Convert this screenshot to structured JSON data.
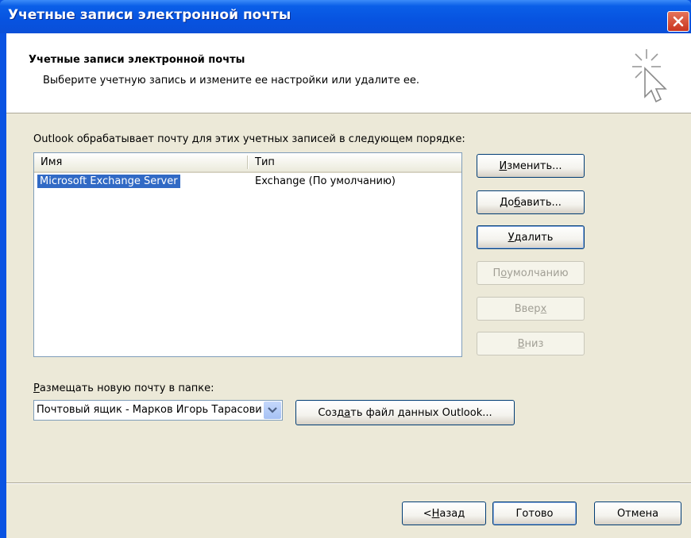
{
  "window": {
    "title": "Учетные записи электронной почты",
    "close_icon": "close-icon"
  },
  "header": {
    "title": "Учетные записи электронной почты",
    "subtitle": "Выберите учетную запись и измените ее настройки или удалите ее."
  },
  "accounts": {
    "intro": "Outlook обрабатывает почту для этих учетных записей в следующем порядке:",
    "columns": [
      "Имя",
      "Тип"
    ],
    "rows": [
      {
        "name": "Microsoft Exchange Server",
        "type": "Exchange (По умолчанию)",
        "selected": true
      }
    ]
  },
  "buttons": {
    "change": {
      "pre": "",
      "key": "И",
      "post": "зменить..."
    },
    "add": {
      "pre": "До",
      "key": "б",
      "post": "авить..."
    },
    "remove": {
      "pre": "",
      "key": "У",
      "post": "далить"
    },
    "default": {
      "pre": "П",
      "key": "о",
      "post": " умолчанию"
    },
    "up": {
      "pre": "Ввер",
      "key": "х",
      "post": ""
    },
    "down": {
      "pre": "",
      "key": "В",
      "post": "низ"
    }
  },
  "delivery": {
    "label_key": "Р",
    "label_rest": "азмещать новую почту в папке:",
    "selected": "Почтовый ящик - Марков Игорь Тарасович",
    "new_file": {
      "pre": "Созд",
      "key": "а",
      "post": "ть файл данных Outlook..."
    }
  },
  "footer": {
    "back": {
      "pre": "< ",
      "key": "Н",
      "post": "азад"
    },
    "finish": "Готово",
    "cancel": "Отмена"
  },
  "colors": {
    "title_bar": "#0753e0",
    "selection": "#316ac5",
    "dialog_bg": "#ece9d8"
  }
}
